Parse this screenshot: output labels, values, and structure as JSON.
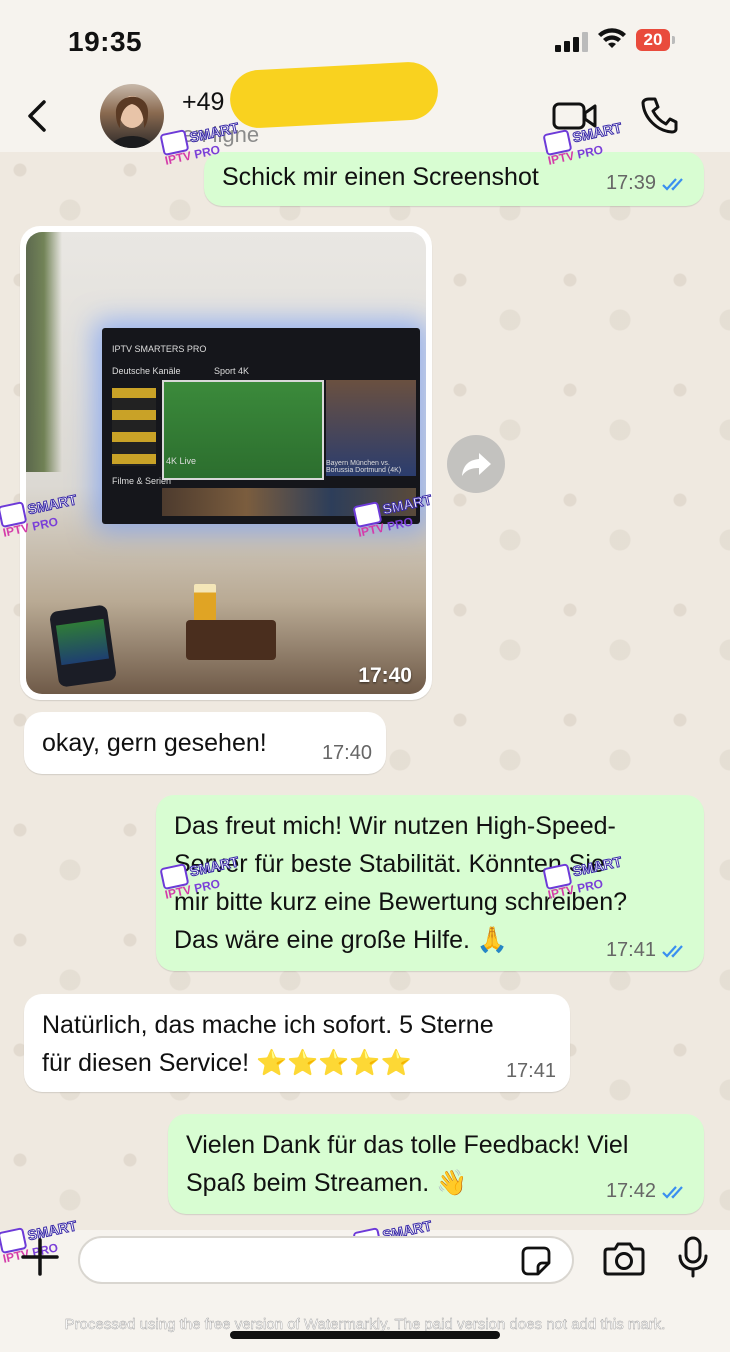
{
  "status_bar": {
    "time": "19:35",
    "battery": "20"
  },
  "header": {
    "number_prefix": "+49",
    "status": "en ligne"
  },
  "messages": [
    {
      "dir": "out",
      "text": "Schick mir einen Screenshot",
      "time": "17:39"
    },
    {
      "dir": "in",
      "type": "image",
      "time": "17:40"
    },
    {
      "dir": "in",
      "text": "okay, gern gesehen!",
      "time": "17:40"
    },
    {
      "dir": "out",
      "lines": [
        "Das freut mich! Wir nutzen High-Speed-",
        "Server für beste Stabilität. Könnten Sie",
        "mir bitte kurz eine Bewertung schreiben?",
        "Das wäre eine große Hilfe. 🙏"
      ],
      "time": "17:41"
    },
    {
      "dir": "in",
      "lines": [
        "Natürlich, das mache ich sofort. 5 Sterne",
        "für diesen Service! ⭐⭐⭐⭐⭐"
      ],
      "time": "17:41"
    },
    {
      "dir": "out",
      "lines": [
        "Vielen Dank für das tolle Feedback! Viel",
        "Spaß beim Streamen. 👋"
      ],
      "time": "17:42"
    }
  ],
  "tv_screen": {
    "menu": "IPTV SMARTERS PRO",
    "category": "Deutsche Kanäle",
    "featured": "Sport 4K",
    "live": "4K Live",
    "match": "Bayern München vs. Borussia Dortmund (4K)",
    "row_title": "Filme & Serien"
  },
  "watermark": {
    "top": "SMART",
    "bottom": "IPTV",
    "badge": "PRO"
  },
  "footer_note": "Processed using the free version of Watermarkly. The paid version does not add this mark.",
  "colors": {
    "outgoing": "#d8fdd2",
    "incoming": "#ffffff",
    "tick": "#3a8ff0",
    "battery": "#e94b3c",
    "redaction": "#f9d21f"
  },
  "icons": [
    "back-icon",
    "video-call-icon",
    "phone-icon",
    "forward-icon",
    "plus-icon",
    "sticker-icon",
    "camera-icon",
    "mic-icon"
  ]
}
